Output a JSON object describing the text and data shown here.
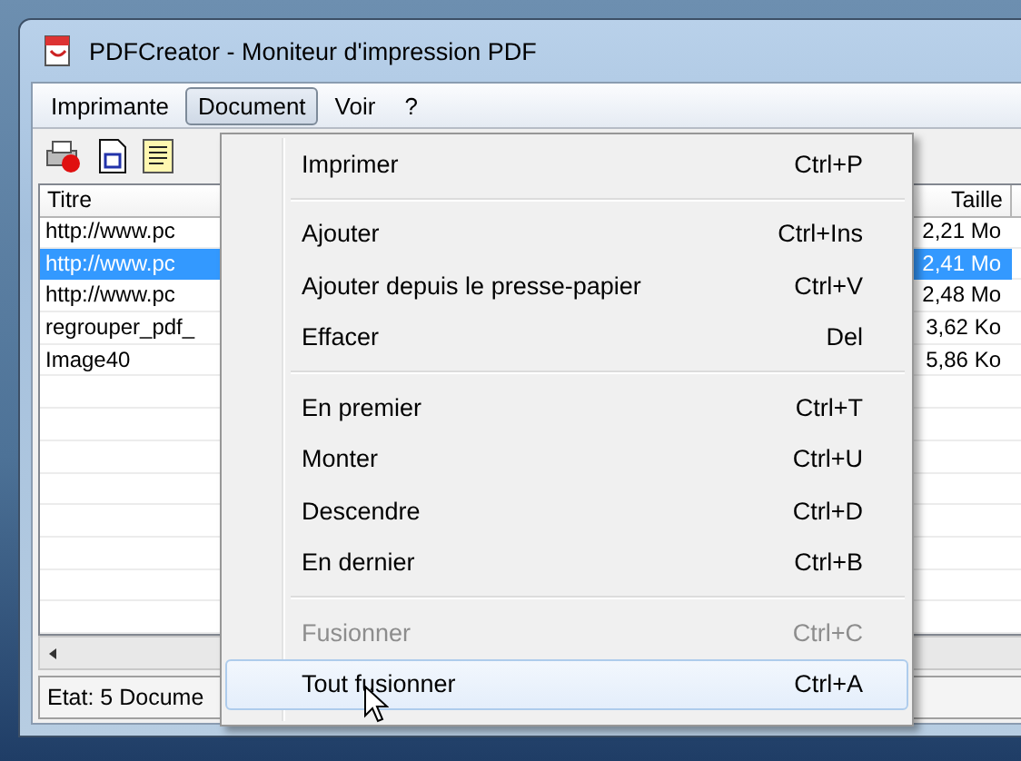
{
  "window": {
    "title": "PDFCreator - Moniteur d'impression PDF"
  },
  "menubar": [
    {
      "label": "Imprimante",
      "selected": false
    },
    {
      "label": "Document",
      "selected": true
    },
    {
      "label": "Voir",
      "selected": false
    },
    {
      "label": "?",
      "selected": false
    }
  ],
  "table": {
    "columns": [
      "Titre",
      "Taille"
    ],
    "rows": [
      {
        "title": "http://www.pc",
        "size": "2,21 Mo",
        "selected": false
      },
      {
        "title": "http://www.pc",
        "size": "2,41 Mo",
        "selected": true
      },
      {
        "title": "http://www.pc",
        "size": "2,48 Mo",
        "selected": false
      },
      {
        "title": "regrouper_pdf_",
        "size": "3,62 Ko",
        "selected": false
      },
      {
        "title": "Image40",
        "size": "5,86 Ko",
        "selected": false
      }
    ]
  },
  "status_bar": "Etat: 5 Docume",
  "menu": {
    "groups": [
      [
        {
          "label": "Imprimer",
          "shortcut": "Ctrl+P",
          "disabled": false,
          "highlighted": false
        }
      ],
      [
        {
          "label": "Ajouter",
          "shortcut": "Ctrl+Ins",
          "disabled": false,
          "highlighted": false
        },
        {
          "label": "Ajouter depuis le presse-papier",
          "shortcut": "Ctrl+V",
          "disabled": false,
          "highlighted": false
        },
        {
          "label": "Effacer",
          "shortcut": "Del",
          "disabled": false,
          "highlighted": false
        }
      ],
      [
        {
          "label": "En premier",
          "shortcut": "Ctrl+T",
          "disabled": false,
          "highlighted": false
        },
        {
          "label": "Monter",
          "shortcut": "Ctrl+U",
          "disabled": false,
          "highlighted": false
        },
        {
          "label": "Descendre",
          "shortcut": "Ctrl+D",
          "disabled": false,
          "highlighted": false
        },
        {
          "label": "En dernier",
          "shortcut": "Ctrl+B",
          "disabled": false,
          "highlighted": false
        }
      ],
      [
        {
          "label": "Fusionner",
          "shortcut": "Ctrl+C",
          "disabled": true,
          "highlighted": false
        },
        {
          "label": "Tout fusionner",
          "shortcut": "Ctrl+A",
          "disabled": false,
          "highlighted": true
        }
      ]
    ]
  }
}
